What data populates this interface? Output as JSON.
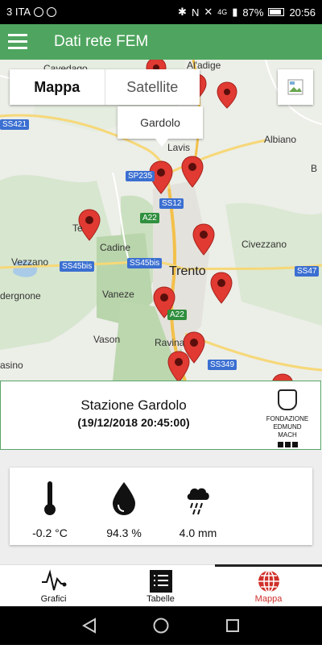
{
  "status_bar": {
    "carrier": "3 ITA",
    "network": "4G",
    "battery": "87%",
    "time": "20:56"
  },
  "app_bar": {
    "title": "Dati rete FEM"
  },
  "map": {
    "toggle": {
      "map_label": "Mappa",
      "satellite_label": "Satellite",
      "selected": "Mappa"
    },
    "info_window": {
      "title": "Gardolo"
    },
    "labels": [
      "Cavedago",
      "Albiano",
      "Lavis",
      "Cadine",
      "Civezzano",
      "Vezzano",
      "Trento",
      "Vaneze",
      "Vason",
      "Ravina",
      "dergnone",
      "asino",
      "Te",
      "B",
      "Al'adige"
    ],
    "shields": [
      "SS421",
      "SP235",
      "SS12",
      "A22",
      "SS45bis",
      "SS45bis",
      "A22",
      "SS47",
      "SS349"
    ]
  },
  "station": {
    "name": "Stazione Gardolo",
    "datetime": "(19/12/2018 20:45:00)",
    "logo_line1": "FONDAZIONE",
    "logo_line2": "EDMUND MACH"
  },
  "metrics": {
    "temperature": "-0.2 °C",
    "humidity": "94.3 %",
    "rain": "4.0 mm"
  },
  "bottom_nav": {
    "items": [
      {
        "label": "Grafici"
      },
      {
        "label": "Tabelle"
      },
      {
        "label": "Mappa"
      }
    ],
    "active": "Mappa"
  },
  "colors": {
    "app_bar": "#4fa55f",
    "accent_red": "#d0302b",
    "marker_red": "#e03a32"
  }
}
